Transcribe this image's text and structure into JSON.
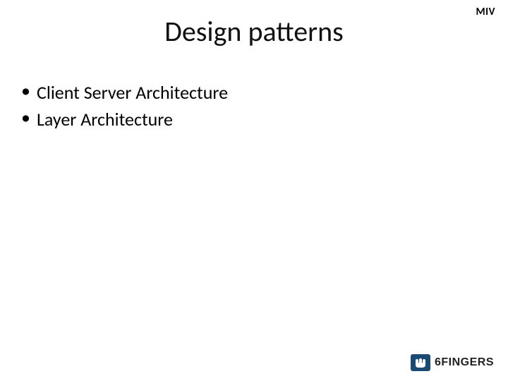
{
  "header": {
    "corner_label": "MIV",
    "title": "Design patterns"
  },
  "bullets": {
    "items": [
      "Client Server Architecture",
      "Layer Architecture"
    ]
  },
  "footer": {
    "brand_number": "6",
    "brand_text": "FINGERS"
  }
}
